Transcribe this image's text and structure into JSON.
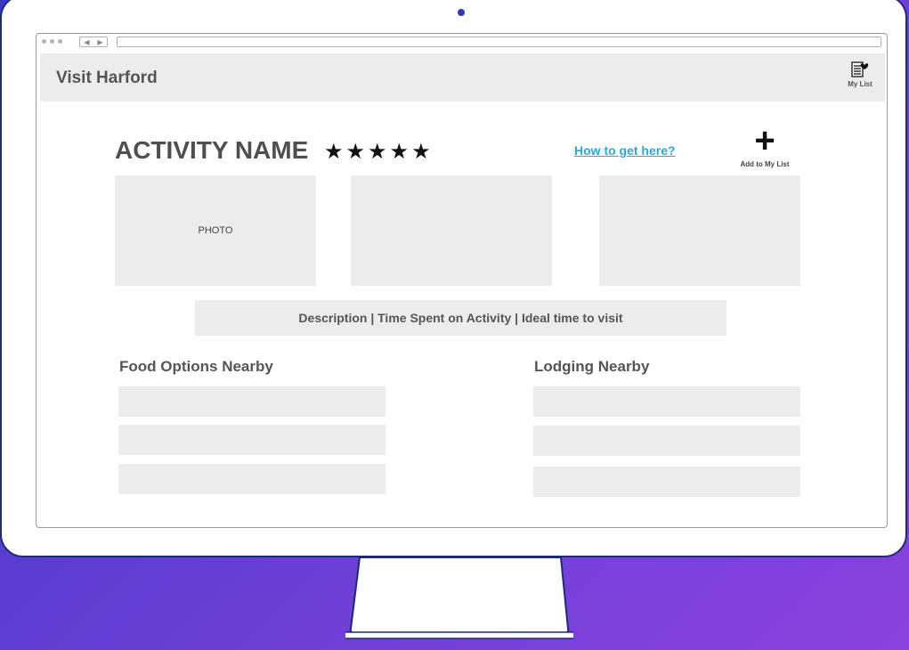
{
  "header": {
    "site_title": "Visit Harford",
    "my_list_label": "My List",
    "my_list_icon": "list-heart-icon"
  },
  "activity": {
    "name": "ACTIVITY NAME",
    "stars": "★★★★★",
    "rating": 5,
    "directions_link": "How to get here?",
    "add_icon": "plus-icon",
    "add_label": "Add to My List"
  },
  "photos": [
    "PHOTO",
    "",
    ""
  ],
  "description_bar": "Description | Time Spent on Activity | Ideal time to visit",
  "food": {
    "title": "Food Options Nearby",
    "items": [
      "",
      "",
      ""
    ]
  },
  "lodging": {
    "title": "Lodging Nearby",
    "items": [
      "",
      "",
      ""
    ]
  },
  "colors": {
    "background_start": "#3a37c4",
    "background_end": "#8b41de",
    "monitor_border": "#1d2a7a",
    "placeholder_gray": "#ececec",
    "link_blue": "#27a8e0"
  }
}
